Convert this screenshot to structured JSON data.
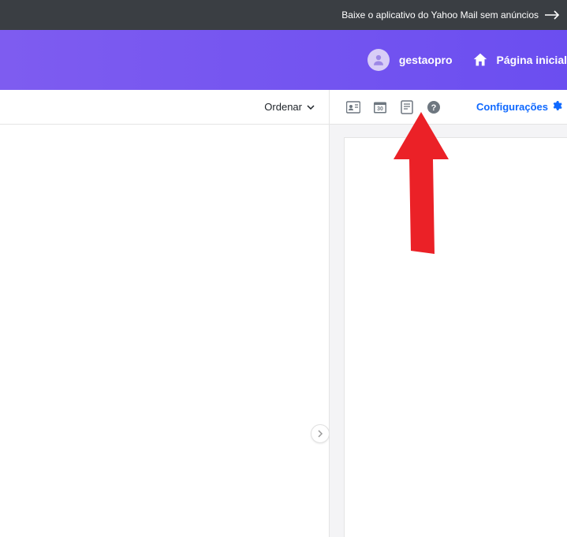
{
  "banner": {
    "text": "Baixe o aplicativo do Yahoo Mail sem anúncios"
  },
  "header": {
    "username": "gestaopro",
    "home_label": "Página inicial"
  },
  "toolbar": {
    "sort_label": "Ordenar",
    "config_label": "Configurações",
    "calendar_day": "30"
  }
}
